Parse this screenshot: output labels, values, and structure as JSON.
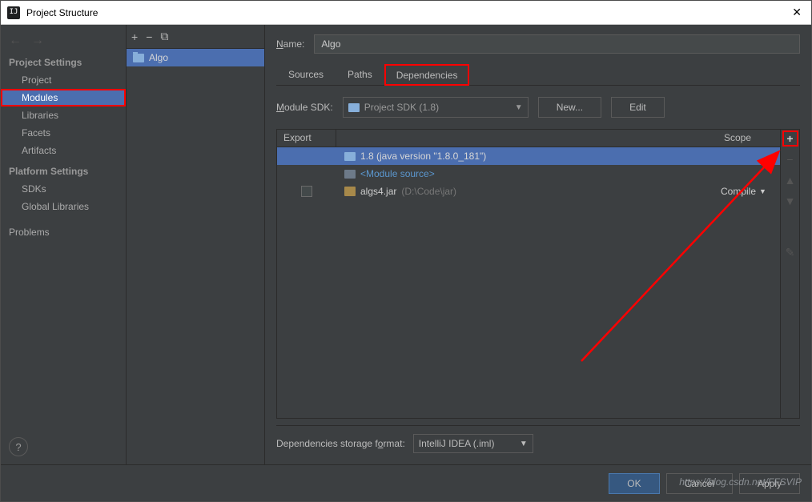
{
  "window": {
    "title": "Project Structure",
    "app_icon_text": "IJ"
  },
  "nav": {
    "section1": "Project Settings",
    "items1": [
      "Project",
      "Modules",
      "Libraries",
      "Facets",
      "Artifacts"
    ],
    "section2": "Platform Settings",
    "items2": [
      "SDKs",
      "Global Libraries"
    ],
    "section3_item": "Problems"
  },
  "tree": {
    "module_name": "Algo"
  },
  "main": {
    "name_label": "Name:",
    "name_value": "Algo",
    "tabs": [
      "Sources",
      "Paths",
      "Dependencies"
    ],
    "module_sdk_label": "Module SDK:",
    "module_sdk_value": "Project SDK (1.8)",
    "new_btn": "New...",
    "edit_btn": "Edit",
    "deps_header_export": "Export",
    "deps_header_scope": "Scope",
    "deps": [
      {
        "text": "1.8 (java version \"1.8.0_181\")",
        "selected": true,
        "icon": "folder",
        "scope": "",
        "checkbox": false
      },
      {
        "text": "<Module source>",
        "selected": false,
        "icon": "folder-grey",
        "scope": "",
        "blue": true,
        "checkbox": false
      },
      {
        "text": "algs4.jar",
        "tail": "(D:\\Code\\jar)",
        "selected": false,
        "icon": "lib",
        "scope": "Compile",
        "checkbox": true
      }
    ],
    "storage_label": "Dependencies storage format:",
    "storage_value": "IntelliJ IDEA (.iml)"
  },
  "footer": {
    "ok": "OK",
    "cancel": "Cancel",
    "apply": "Apply",
    "watermark": "https://blog.csdn.net/FFSVIP"
  }
}
